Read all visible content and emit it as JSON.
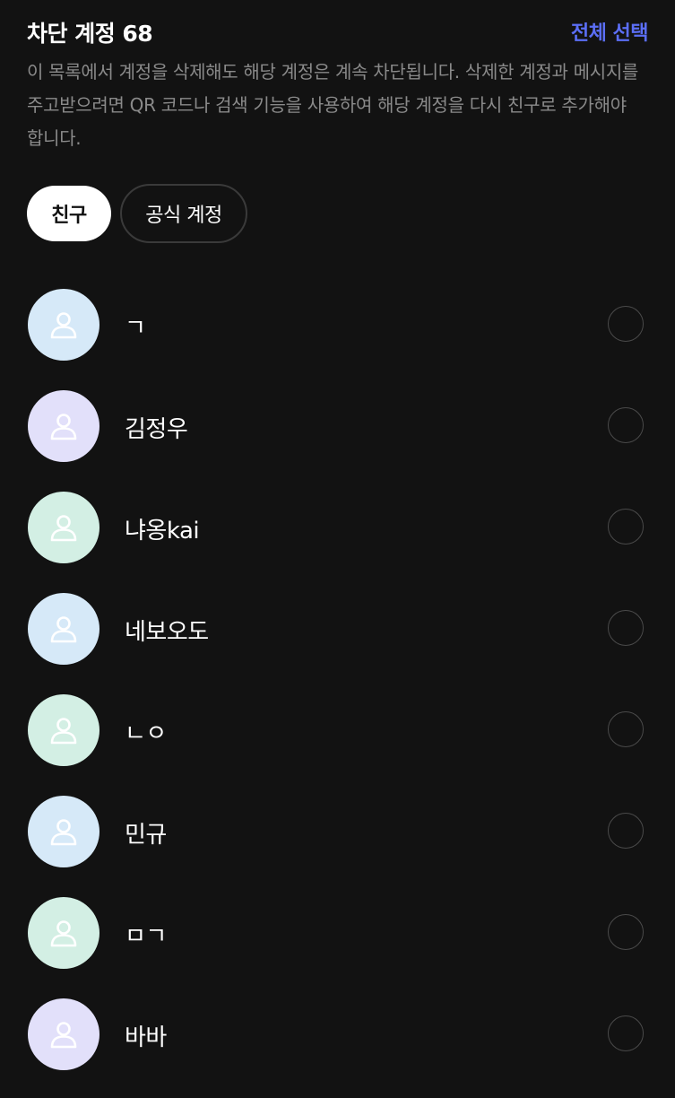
{
  "header": {
    "title": "차단 계정 68",
    "select_all": "전체 선택"
  },
  "notice": "이 목록에서 계정을 삭제해도 해당 계정은 계속 차단됩니다. 삭제한 계정과 메시지를 주고받으려면 QR 코드나 검색 기능을 사용하여 해당 계정을 다시 친구로 추가해야 합니다.",
  "tabs": [
    {
      "label": "친구",
      "active": true
    },
    {
      "label": "공식 계정",
      "active": false
    }
  ],
  "colors": {
    "accent": "#5b6ef5",
    "avatar_blue": "#d6e9f8",
    "avatar_purple": "#e2e0fa",
    "avatar_green": "#d3efe4"
  },
  "accounts": [
    {
      "name": "ㄱ",
      "avatar_color": "#d6e9f8"
    },
    {
      "name": "김정우",
      "avatar_color": "#e2e0fa"
    },
    {
      "name": "냐옹kai",
      "avatar_color": "#d3efe4"
    },
    {
      "name": "네보오도",
      "avatar_color": "#d6e9f8"
    },
    {
      "name": "ㄴㅇ",
      "avatar_color": "#d3efe4"
    },
    {
      "name": "민규",
      "avatar_color": "#d6e9f8"
    },
    {
      "name": "ㅁㄱ",
      "avatar_color": "#d3efe4"
    },
    {
      "name": "바바",
      "avatar_color": "#e2e0fa"
    }
  ]
}
